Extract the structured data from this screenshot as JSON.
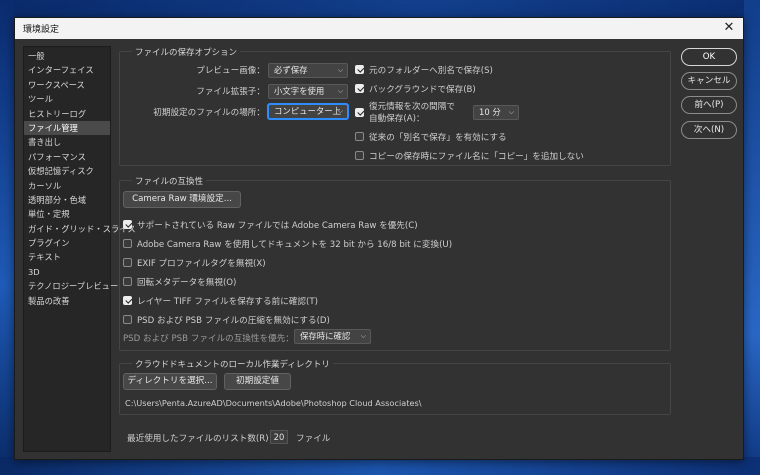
{
  "window": {
    "title": "環境設定",
    "close_glyph": "✕"
  },
  "sidebar": {
    "items": [
      {
        "label": "一般"
      },
      {
        "label": "インターフェイス"
      },
      {
        "label": "ワークスペース"
      },
      {
        "label": "ツール"
      },
      {
        "label": "ヒストリーログ"
      },
      {
        "label": "ファイル管理"
      },
      {
        "label": "書き出し"
      },
      {
        "label": "パフォーマンス"
      },
      {
        "label": "仮想記憶ディスク"
      },
      {
        "label": "カーソル"
      },
      {
        "label": "透明部分・色域"
      },
      {
        "label": "単位・定規"
      },
      {
        "label": "ガイド・グリッド・スライス"
      },
      {
        "label": "プラグイン"
      },
      {
        "label": "テキスト"
      },
      {
        "label": "3D"
      },
      {
        "label": "テクノロジープレビュー"
      },
      {
        "label": "製品の改善"
      }
    ],
    "active_index": 5
  },
  "save_options": {
    "title": "ファイルの保存オプション",
    "preview_label": "プレビュー画像：",
    "preview_value": "必ず保存",
    "extension_label": "ファイル拡張子：",
    "extension_value": "小文字を使用",
    "location_label": "初期設定のファイルの場所：",
    "location_value": "コンピューター上",
    "save_as_original_folder": {
      "label": "元のフォルダーへ別名で保存(S)",
      "checked": true
    },
    "background_save": {
      "label": "バックグラウンドで保存(B)",
      "checked": true
    },
    "auto_recovery": {
      "label_line1": "復元情報を次の間隔で",
      "label_line2": "自動保存(A)：",
      "checked": true
    },
    "auto_recovery_interval": "10 分",
    "legacy_save_as": {
      "label": "従来の「別名で保存」を有効にする",
      "checked": false
    },
    "copy_suffix": {
      "label": "コピーの保存時にファイル名に「コピー」を追加しない",
      "checked": false
    }
  },
  "compat": {
    "title": "ファイルの互換性",
    "camera_raw_button": "Camera Raw 環境設定...",
    "options": [
      {
        "label": "サポートされている Raw ファイルでは Adobe Camera Raw を優先(C)",
        "checked": true
      },
      {
        "label": "Adobe Camera Raw を使用してドキュメントを 32 bit から 16/8 bit に変換(U)",
        "checked": false
      },
      {
        "label": "EXIF プロファイルタグを無視(X)",
        "checked": false
      },
      {
        "label": "回転メタデータを無視(O)",
        "checked": false
      },
      {
        "label": "レイヤー TIFF ファイルを保存する前に確認(T)",
        "checked": true
      },
      {
        "label": "PSD および PSB ファイルの圧縮を無効にする(D)",
        "checked": false
      }
    ],
    "maximize_label": "PSD および PSB ファイルの互換性を優先：",
    "maximize_value": "保存時に確認"
  },
  "cloud": {
    "title": "クラウドドキュメントのローカル作業ディレクトリ",
    "choose_button": "ディレクトリを選択...",
    "default_button": "初期設定値",
    "path": "C:\\Users\\Penta.AzureAD\\Documents\\Adobe\\Photoshop Cloud Associates\\"
  },
  "recent": {
    "label": "最近使用したファイルのリスト数(R)：",
    "value": "20",
    "unit": "ファイル"
  },
  "buttons": {
    "ok": "OK",
    "cancel": "キャンセル",
    "prev": "前へ(P)",
    "next": "次へ(N)"
  }
}
